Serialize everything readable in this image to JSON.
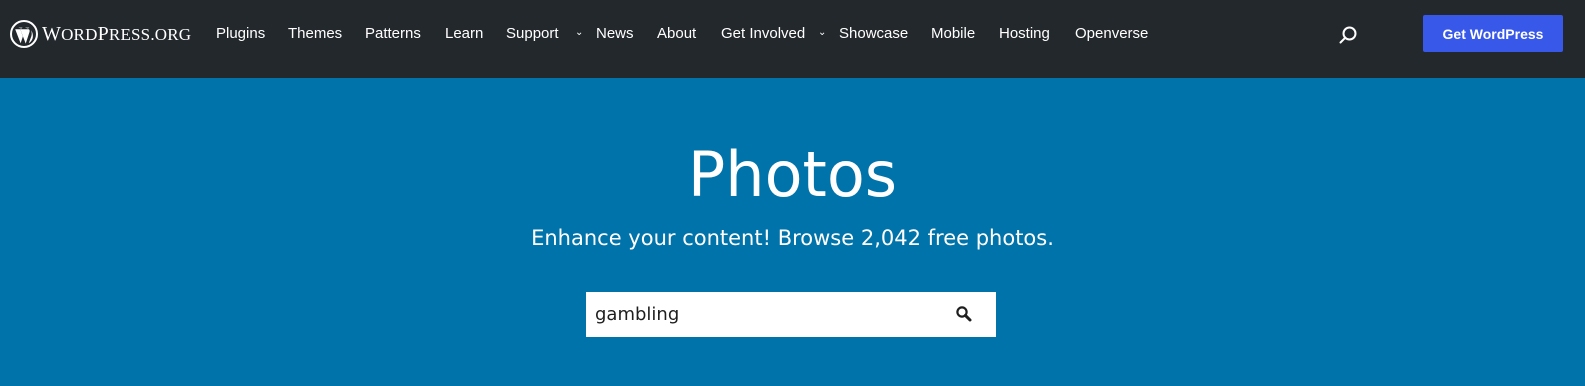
{
  "header": {
    "logo_text_first": "W",
    "logo_text_mid": "ORD",
    "logo_text_p": "P",
    "logo_text_rest": "RESS",
    "logo_text_org": ".ORG",
    "nav_items": [
      {
        "label": "Plugins"
      },
      {
        "label": "Themes"
      },
      {
        "label": "Patterns"
      },
      {
        "label": "Learn"
      },
      {
        "label": "Support"
      },
      {
        "label": "News"
      },
      {
        "label": "About"
      },
      {
        "label": "Get Involved"
      },
      {
        "label": "Showcase"
      },
      {
        "label": "Mobile"
      },
      {
        "label": "Hosting"
      },
      {
        "label": "Openverse"
      }
    ],
    "search_icon": "search-icon",
    "cta_label": "Get WordPress"
  },
  "hero": {
    "title": "Photos",
    "subtitle": "Enhance your content! Browse 2,042 free photos.",
    "search_value": "gambling",
    "search_icon": "magnifier-icon"
  },
  "colors": {
    "header_bg": "#23282d",
    "hero_bg": "#0073aa",
    "cta_bg": "#3858e9",
    "text": "#ffffff"
  }
}
